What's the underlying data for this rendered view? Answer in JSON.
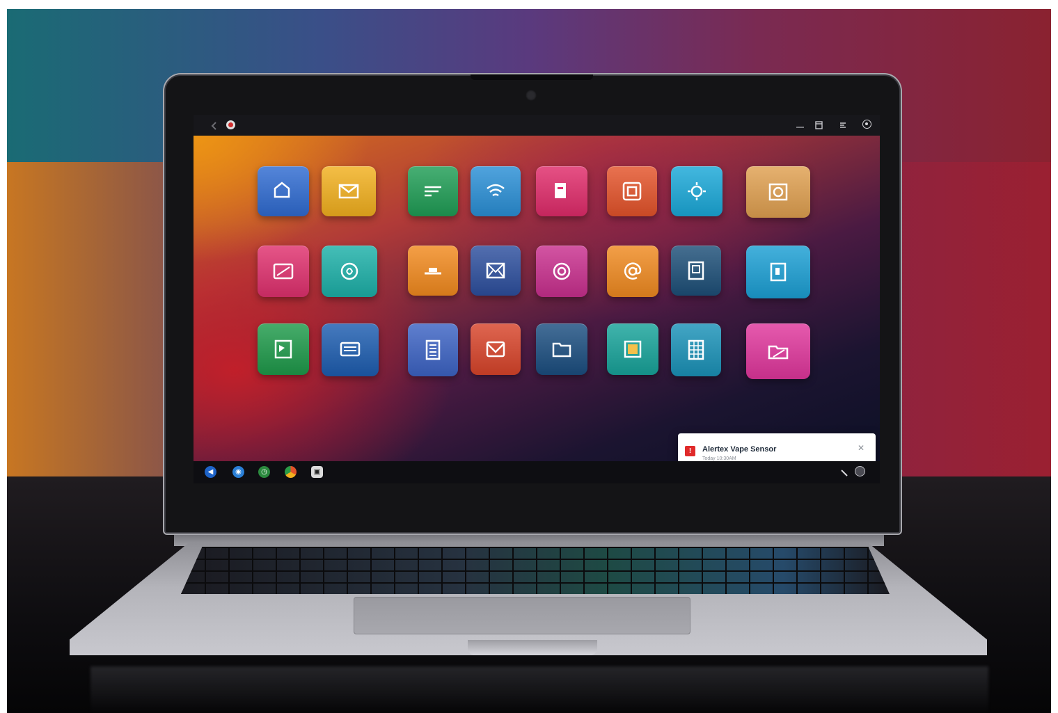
{
  "topbar": {
    "title": "",
    "icons": [
      "back-icon",
      "record-icon",
      "window-icon",
      "cast-icon",
      "settings-icon"
    ]
  },
  "apps": [
    {
      "label": "",
      "icon": "home-icon",
      "color": "#2f6bd1"
    },
    {
      "label": "",
      "icon": "mail-icon",
      "color": "#f2b01e"
    },
    {
      "label": "",
      "icon": "document-icon",
      "color": "#1f9d55"
    },
    {
      "label": "",
      "icon": "wifi-icon",
      "color": "#2a8fd6"
    },
    {
      "label": "",
      "icon": "file-icon",
      "color": "#e02b6a"
    },
    {
      "label": "",
      "icon": "camera-icon",
      "color": "#e4532a"
    },
    {
      "label": "",
      "icon": "settings-icon",
      "color": "#1aa8d8"
    },
    {
      "label": "",
      "icon": "photo-icon",
      "color": "#e0a050"
    },
    {
      "label": "",
      "icon": "tablet-icon",
      "color": "#e0306e"
    },
    {
      "label": "",
      "icon": "messages-icon",
      "color": "#1cb0a8"
    },
    {
      "label": "",
      "icon": "store-icon",
      "color": "#f28a1e"
    },
    {
      "label": "",
      "icon": "inbox-icon",
      "color": "#2d4f9e"
    },
    {
      "label": "",
      "icon": "camera-round-icon",
      "color": "#c92f8e"
    },
    {
      "label": "",
      "icon": "at-sign-icon",
      "color": "#f08a20"
    },
    {
      "label": "",
      "icon": "calculator-icon",
      "color": "#1d4f78"
    },
    {
      "label": "",
      "icon": "book-icon",
      "color": "#1b9fd4"
    },
    {
      "label": "",
      "icon": "image-icon",
      "color": "#1e9a4a"
    },
    {
      "label": "",
      "icon": "monitor-icon",
      "color": "#1d5db0"
    },
    {
      "label": "",
      "icon": "list-icon",
      "color": "#3c63c4"
    },
    {
      "label": "",
      "icon": "envelope-icon",
      "color": "#d8442a"
    },
    {
      "label": "",
      "icon": "folder-icon",
      "color": "#1b4e80"
    },
    {
      "label": "",
      "icon": "frame-icon",
      "color": "#17a39a"
    },
    {
      "label": "",
      "icon": "spreadsheet-icon",
      "color": "#1a92b8"
    },
    {
      "label": "",
      "icon": "folder-open-icon",
      "color": "#e0369c"
    }
  ],
  "notification": {
    "title": "Alertex Vape Sensor",
    "time": "Today 10:30AM",
    "icon": "alert-icon",
    "close_icon": "close-icon"
  },
  "taskbar": {
    "icons": [
      {
        "icon": "start-icon",
        "color": "#1e63c8"
      },
      {
        "icon": "browser-icon",
        "color": "#2a7fd6"
      },
      {
        "icon": "clock-icon",
        "color": "#2b8a3e"
      },
      {
        "icon": "chrome-icon",
        "color": "#e2542a"
      },
      {
        "icon": "camera-app-icon",
        "color": "#dcdcdc"
      }
    ],
    "tray_icons": [
      "wifi-tray-icon",
      "account-icon"
    ]
  }
}
